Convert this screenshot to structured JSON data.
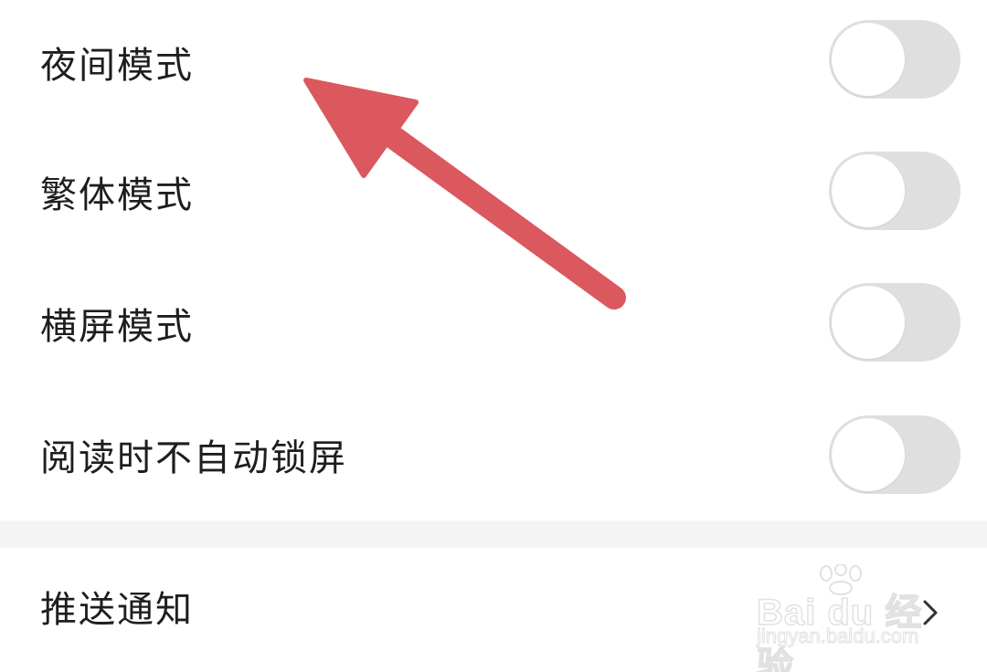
{
  "settings": {
    "items": [
      {
        "label": "夜间模式",
        "enabled": false
      },
      {
        "label": "繁体模式",
        "enabled": false
      },
      {
        "label": "横屏模式",
        "enabled": false
      },
      {
        "label": "阅读时不自动锁屏",
        "enabled": false
      }
    ],
    "push_notification": {
      "label": "推送通知"
    }
  },
  "watermark": {
    "brand": "Bai du 经验",
    "url": "jingyan.baidu.com"
  },
  "colors": {
    "toggle_off": "#dfdfdf",
    "annotation_arrow": "#db585f",
    "text": "#1e1e1e",
    "section_gap": "#f4f4f4"
  }
}
